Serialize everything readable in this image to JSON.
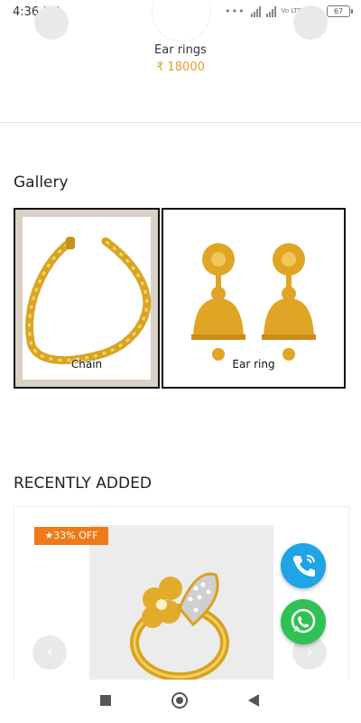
{
  "status": {
    "time": "4:36 PM",
    "network": "Vo LTE",
    "battery": "67"
  },
  "top_product": {
    "name": "Ear rings",
    "price": "₹ 18000"
  },
  "gallery": {
    "title": "Gallery",
    "items": [
      {
        "caption": "Chain"
      },
      {
        "caption": "Ear ring"
      }
    ]
  },
  "recent": {
    "title": "RECENTLY ADDED",
    "offer": "★33% OFF"
  },
  "colors": {
    "price": "#e0a030",
    "offer": "#f07a18",
    "call_fab": "#1fa4e6",
    "whatsapp_fab": "#2fc153"
  }
}
